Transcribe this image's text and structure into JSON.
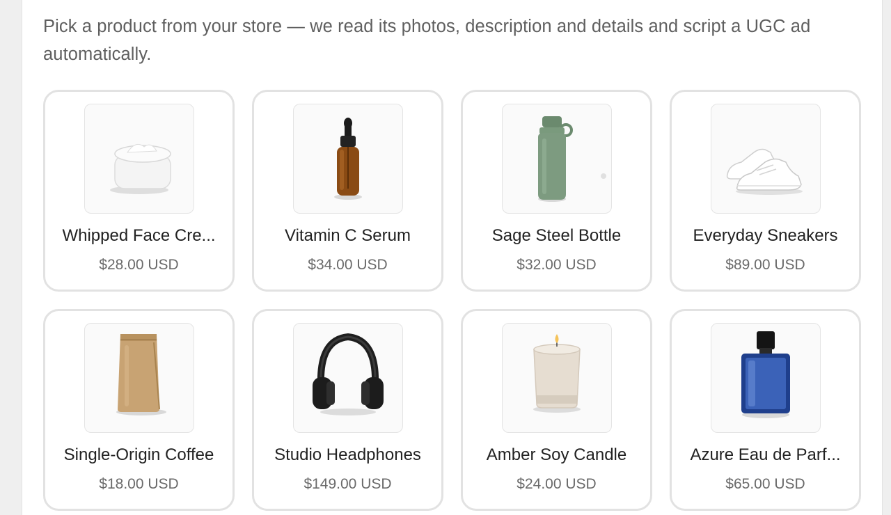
{
  "description": "Pick a product from your store — we read its photos, description and details and script a UGC ad automatically.",
  "products": [
    {
      "name": "Whipped Face Cre...",
      "price": "$28.00 USD",
      "icon": "face-cream-jar-icon"
    },
    {
      "name": "Vitamin C Serum",
      "price": "$34.00 USD",
      "icon": "serum-dropper-bottle-icon"
    },
    {
      "name": "Sage Steel Bottle",
      "price": "$32.00 USD",
      "icon": "steel-water-bottle-icon"
    },
    {
      "name": "Everyday Sneakers",
      "price": "$89.00 USD",
      "icon": "white-sneakers-icon"
    },
    {
      "name": "Single-Origin Coffee",
      "price": "$18.00 USD",
      "icon": "coffee-bag-icon"
    },
    {
      "name": "Studio Headphones",
      "price": "$149.00 USD",
      "icon": "headphones-icon"
    },
    {
      "name": "Amber Soy Candle",
      "price": "$24.00 USD",
      "icon": "candle-jar-icon"
    },
    {
      "name": "Azure Eau de Parf...",
      "price": "$65.00 USD",
      "icon": "perfume-bottle-icon"
    }
  ],
  "colors": {
    "card_border": "#e2e2e2",
    "text_primary": "#222222",
    "text_secondary": "#6a6a6a"
  }
}
